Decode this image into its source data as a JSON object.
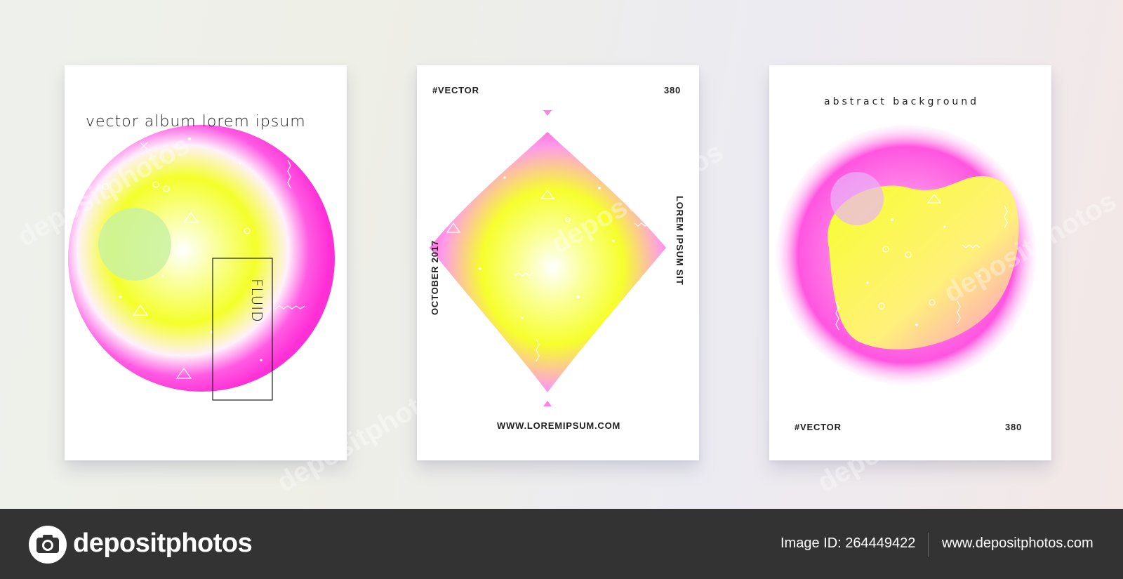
{
  "posters": [
    {
      "title": "vector  album  lorem  ipsum",
      "vertical_word": "FLUID"
    },
    {
      "tag": "#VECTOR",
      "number": "380",
      "left_vertical": "OCTOBER 2017",
      "right_vertical": "LOREM IPSUM SIT",
      "url": "WWW.LOREMIPSUM.COM"
    },
    {
      "title": "abstract background",
      "tag": "#VECTOR",
      "number": "380"
    }
  ],
  "watermark": "depositphotos",
  "footer": {
    "brand": "depositphotos",
    "image_id": "Image ID: 264449422",
    "site": "www.depositphotos.com"
  },
  "colors": {
    "magenta": "#ff2fd6",
    "yellow": "#f7ff2a",
    "footer_bg": "#333333"
  }
}
